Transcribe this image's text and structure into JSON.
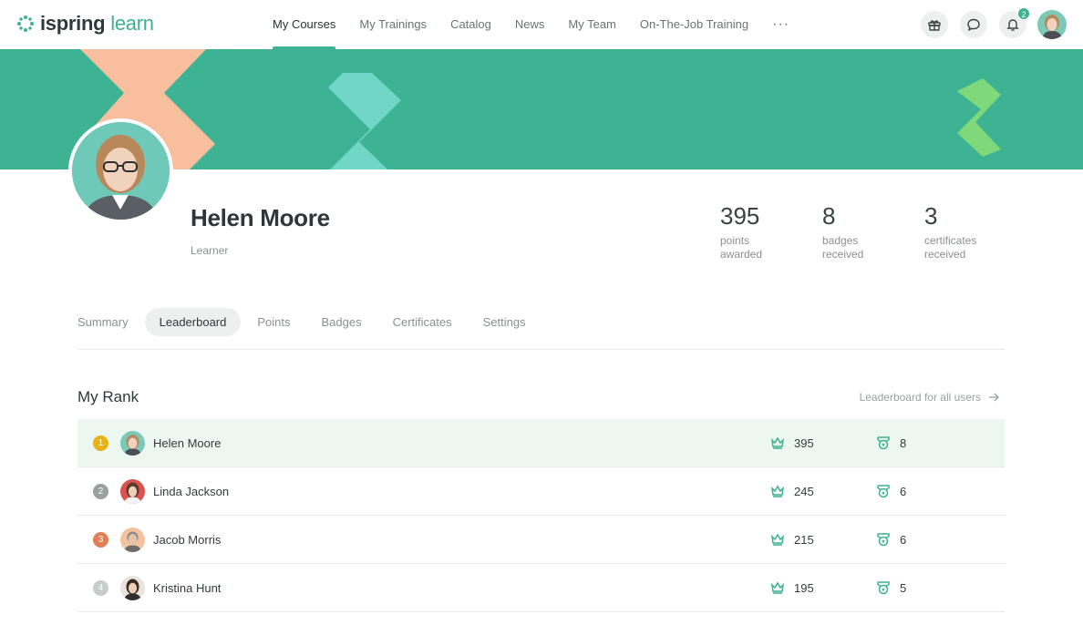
{
  "brand": {
    "name_bold": "ispring",
    "name_light": "learn"
  },
  "nav": {
    "items": [
      {
        "label": "My Courses"
      },
      {
        "label": "My Trainings"
      },
      {
        "label": "Catalog"
      },
      {
        "label": "News"
      },
      {
        "label": "My Team"
      },
      {
        "label": "On-The-Job Training"
      }
    ],
    "more": "···",
    "notifications_count": "2"
  },
  "profile": {
    "name": "Helen Moore",
    "role": "Learner",
    "stats": [
      {
        "value": "395",
        "label": "points awarded"
      },
      {
        "value": "8",
        "label": "badges received"
      },
      {
        "value": "3",
        "label": "certificates received"
      }
    ]
  },
  "tabs": [
    {
      "label": "Summary"
    },
    {
      "label": "Leaderboard"
    },
    {
      "label": "Points"
    },
    {
      "label": "Badges"
    },
    {
      "label": "Certificates"
    },
    {
      "label": "Settings"
    }
  ],
  "rank": {
    "title": "My Rank",
    "all_link": "Leaderboard for all users",
    "rows": [
      {
        "rank": "1",
        "name": "Helen Moore",
        "points": "395",
        "badges": "8",
        "rank_color": "#e7b315"
      },
      {
        "rank": "2",
        "name": "Linda Jackson",
        "points": "245",
        "badges": "6",
        "rank_color": "#9a9fa0"
      },
      {
        "rank": "3",
        "name": "Jacob Morris",
        "points": "215",
        "badges": "6",
        "rank_color": "#e07f53"
      },
      {
        "rank": "4",
        "name": "Kristina Hunt",
        "points": "195",
        "badges": "5",
        "rank_color": "#c8cccc"
      }
    ]
  },
  "colors": {
    "accent": "#3cb28f",
    "banner": "#3db393",
    "highlight_row": "#ecf7f2"
  }
}
